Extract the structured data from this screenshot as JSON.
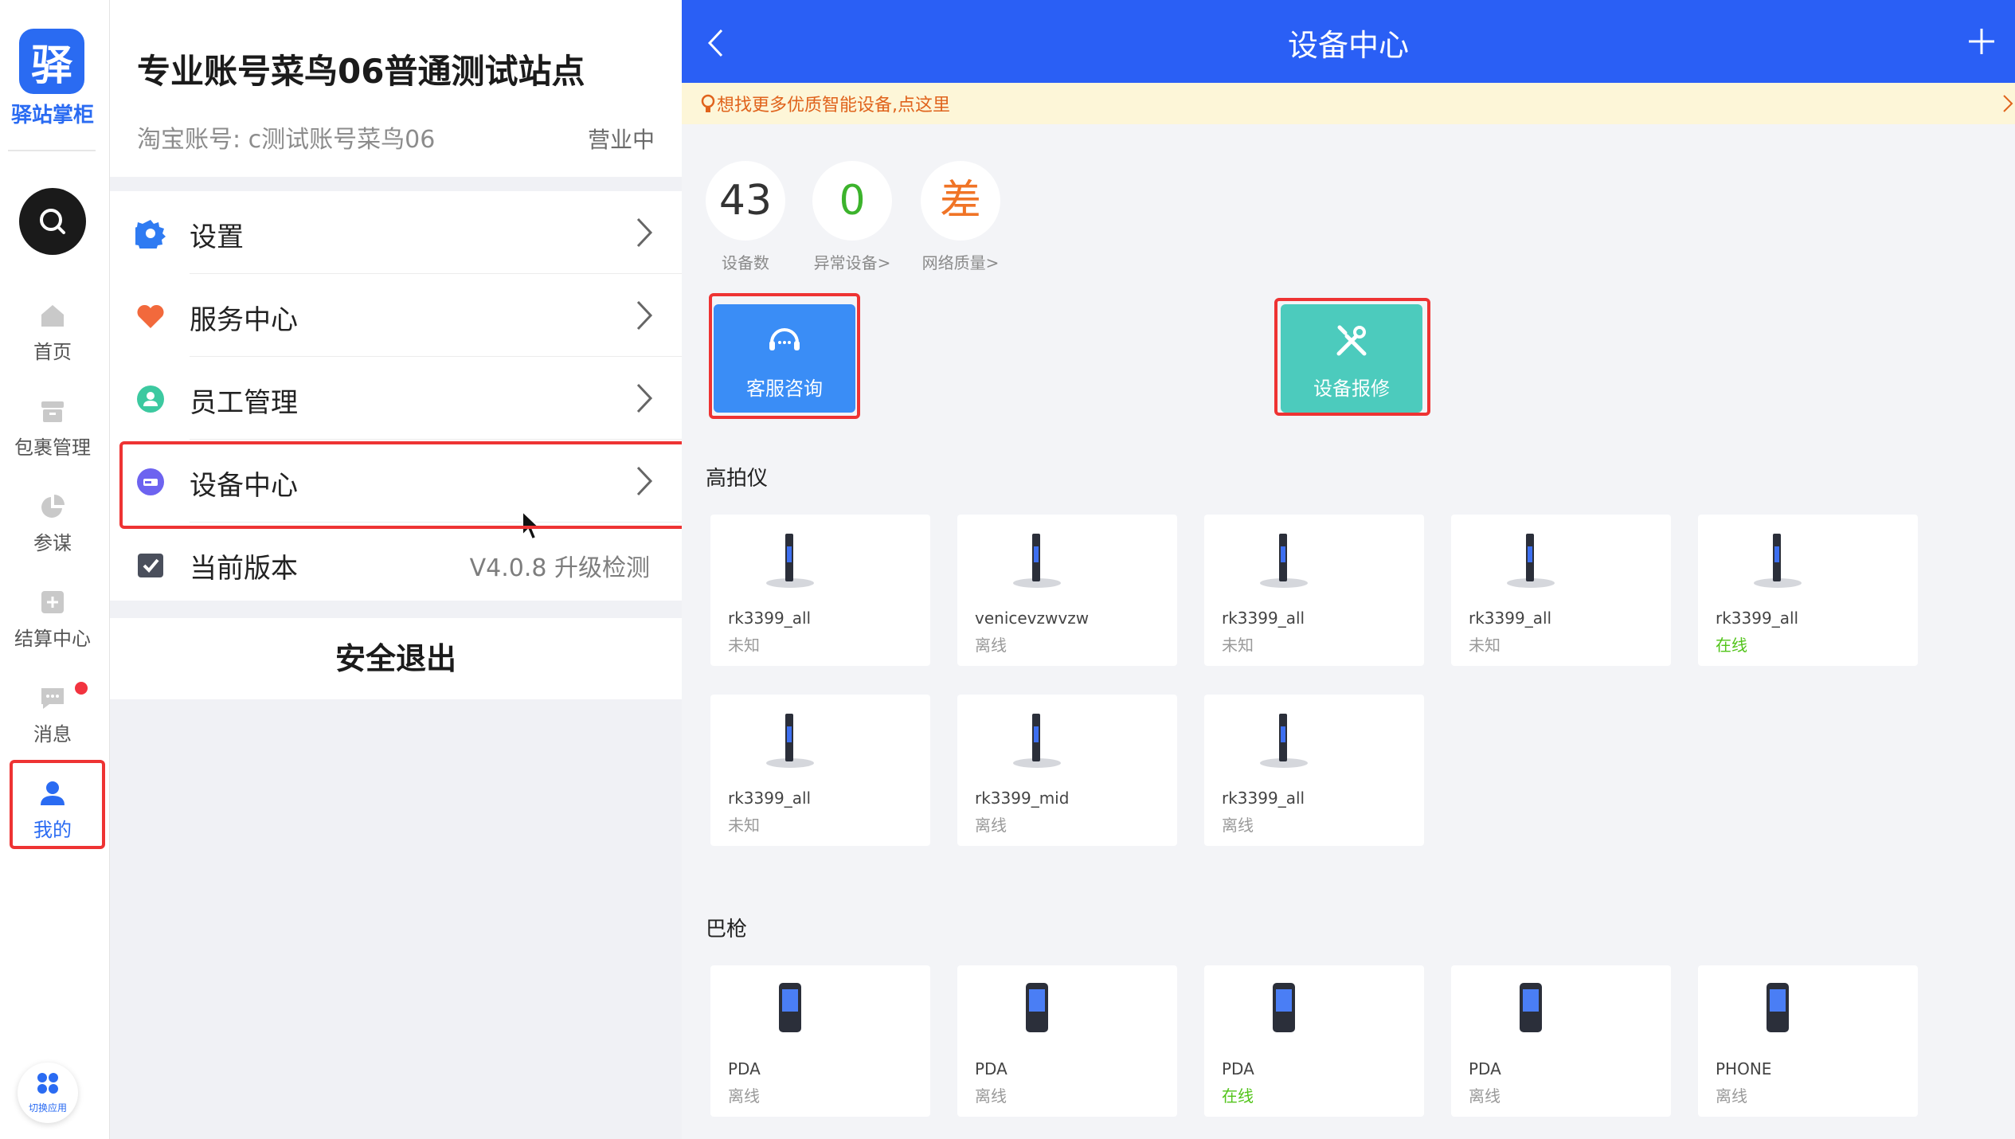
{
  "rail": {
    "logo_char": "驿",
    "logo_text": "驿站掌柜",
    "items": [
      {
        "label": "首页"
      },
      {
        "label": "包裹管理"
      },
      {
        "label": "参谋"
      },
      {
        "label": "结算中心"
      },
      {
        "label": "消息"
      },
      {
        "label": "我的"
      }
    ],
    "switch_app": "切换应用"
  },
  "account": {
    "title": "专业账号菜鸟06普通测试站点",
    "taobao": "淘宝账号: c测试账号菜鸟06",
    "status": "营业中"
  },
  "menu": {
    "items": [
      {
        "label": "设置"
      },
      {
        "label": "服务中心"
      },
      {
        "label": "员工管理"
      },
      {
        "label": "设备中心"
      },
      {
        "label": "当前版本",
        "right": "V4.0.8 升级检测"
      }
    ],
    "logout": "安全退出"
  },
  "device_center": {
    "title": "设备中心",
    "tip": "想找更多优质智能设备,点这里",
    "stats": [
      {
        "value": "43",
        "label": "设备数",
        "color": "#333333"
      },
      {
        "value": "0",
        "label": "异常设备>",
        "color": "#3cb32c"
      },
      {
        "value": "差",
        "label": "网络质量>",
        "color": "#f07426"
      }
    ],
    "actions": [
      {
        "label": "客服咨询",
        "color": "#3a8df6"
      },
      {
        "label": "设备报修",
        "color": "#4ccbbd"
      }
    ],
    "sections": [
      {
        "title": "高拍仪",
        "devices": [
          {
            "name": "rk3399_all",
            "status": "未知"
          },
          {
            "name": "venicevzwvzw",
            "status": "离线"
          },
          {
            "name": "rk3399_all",
            "status": "未知"
          },
          {
            "name": "rk3399_all",
            "status": "未知"
          },
          {
            "name": "rk3399_all",
            "status": "在线"
          },
          {
            "name": "rk3399_all",
            "status": "未知"
          },
          {
            "name": "rk3399_mid",
            "status": "离线"
          },
          {
            "name": "rk3399_all",
            "status": "离线"
          }
        ]
      },
      {
        "title": "巴枪",
        "devices": [
          {
            "name": "PDA",
            "status": "离线"
          },
          {
            "name": "PDA",
            "status": "离线"
          },
          {
            "name": "PDA",
            "status": "在线"
          },
          {
            "name": "PDA",
            "status": "离线"
          },
          {
            "name": "PHONE",
            "status": "离线"
          }
        ]
      }
    ]
  },
  "colors": {
    "brand_blue": "#2a5ff5",
    "highlight_red": "#e33333",
    "online_green": "#52c41a",
    "tip_orange": "#e0631c"
  }
}
